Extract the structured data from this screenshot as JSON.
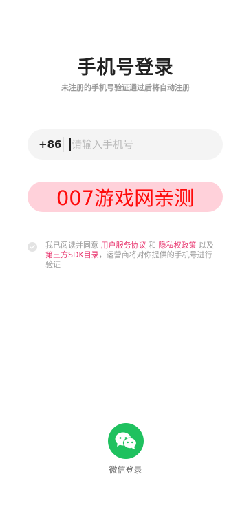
{
  "page": {
    "title": "手机号登录",
    "subtitle": "未注册的手机号验证通过后将自动注册"
  },
  "phone": {
    "country_code": "+86",
    "placeholder": "请输入手机号",
    "value": ""
  },
  "login_button": {
    "label": "007游戏网亲测"
  },
  "agreement": {
    "checked": false,
    "prefix": "我已阅读并同意 ",
    "user_agreement": "用户服务协议",
    "and": " 和 ",
    "privacy_policy": "隐私权政策",
    "and2": " 以及 ",
    "sdk_list": "第三方SDK目录",
    "suffix": "，运营商将对你提供的手机号进行验证"
  },
  "wechat": {
    "label": "微信登录",
    "icon": "wechat-icon"
  },
  "colors": {
    "accent_pink": "#e8336d",
    "button_bg": "#ffd1da",
    "wechat_green": "#1fc15f"
  }
}
